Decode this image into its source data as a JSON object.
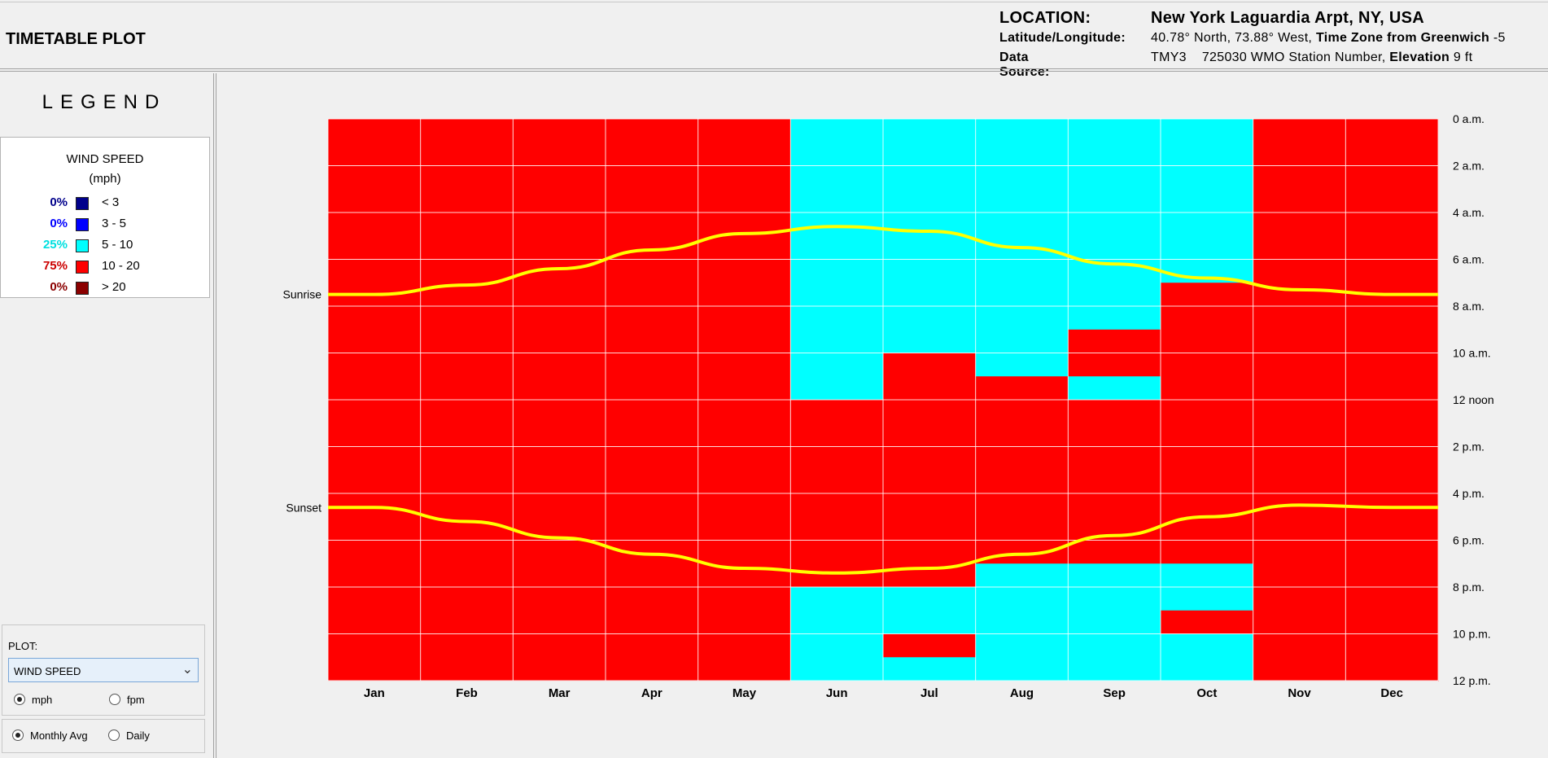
{
  "header": {
    "app_title": "TIMETABLE PLOT",
    "location_label": "LOCATION:",
    "location_value": "New York Laguardia Arpt, NY, USA",
    "latlon_label": "Latitude/Longitude:",
    "latlon_value": "40.78° North, 73.88° West,",
    "timezone_label": "Time Zone from Greenwich",
    "timezone_value": "-5",
    "source_label": "Data Source:",
    "source_value": "TMY3",
    "station_value": "725030 WMO Station Number,",
    "elevation_label": "Elevation",
    "elevation_value": "9 ft"
  },
  "legend": {
    "title": "LEGEND",
    "heading": "WIND SPEED",
    "unit": "(mph)",
    "rows": [
      {
        "pct": "0%",
        "range": "< 3",
        "color": "#00008b",
        "pct_color": "#00008b"
      },
      {
        "pct": "0%",
        "range": "3 - 5",
        "color": "#0000ff",
        "pct_color": "#0000ff"
      },
      {
        "pct": "25%",
        "range": "5 - 10",
        "color": "#00ffff",
        "pct_color": "#00e0e0"
      },
      {
        "pct": "75%",
        "range": "10 - 20",
        "color": "#ff0000",
        "pct_color": "#cc0000"
      },
      {
        "pct": "0%",
        "range": "> 20",
        "color": "#8b0000",
        "pct_color": "#8b0000"
      }
    ]
  },
  "controls": {
    "plot_label": "PLOT:",
    "plot_selected": "WIND SPEED",
    "unit_options": [
      "mph",
      "fpm"
    ],
    "unit_selected": "mph",
    "avg_options": [
      "Monthly Avg",
      "Daily"
    ],
    "avg_selected": "Monthly Avg"
  },
  "chart_data": {
    "type": "heatmap",
    "x": [
      "Jan",
      "Feb",
      "Mar",
      "Apr",
      "May",
      "Jun",
      "Jul",
      "Aug",
      "Sep",
      "Oct",
      "Nov",
      "Dec"
    ],
    "y_ticks": [
      "0 a.m.",
      "2 a.m.",
      "4 a.m.",
      "6 a.m.",
      "8 a.m.",
      "10 a.m.",
      "12 noon",
      "2 p.m.",
      "4 p.m.",
      "6 p.m.",
      "8 p.m.",
      "10 p.m.",
      "12 p.m."
    ],
    "y_range_hours": [
      0,
      24
    ],
    "colors": {
      "5-10": "#00ffff",
      "10-20": "#ff0000"
    },
    "cells": [
      [
        "10-20",
        "10-20",
        "10-20",
        "10-20",
        "10-20",
        "10-20",
        "10-20",
        "10-20",
        "10-20",
        "10-20",
        "10-20",
        "10-20",
        "10-20",
        "10-20",
        "10-20",
        "10-20",
        "10-20",
        "10-20",
        "10-20",
        "10-20",
        "10-20",
        "10-20",
        "10-20",
        "10-20"
      ],
      [
        "10-20",
        "10-20",
        "10-20",
        "10-20",
        "10-20",
        "10-20",
        "10-20",
        "10-20",
        "10-20",
        "10-20",
        "10-20",
        "10-20",
        "10-20",
        "10-20",
        "10-20",
        "10-20",
        "10-20",
        "10-20",
        "10-20",
        "10-20",
        "10-20",
        "10-20",
        "10-20",
        "10-20"
      ],
      [
        "10-20",
        "10-20",
        "10-20",
        "10-20",
        "10-20",
        "10-20",
        "10-20",
        "10-20",
        "10-20",
        "10-20",
        "10-20",
        "10-20",
        "10-20",
        "10-20",
        "10-20",
        "10-20",
        "10-20",
        "10-20",
        "10-20",
        "10-20",
        "10-20",
        "10-20",
        "10-20",
        "10-20"
      ],
      [
        "10-20",
        "10-20",
        "10-20",
        "10-20",
        "10-20",
        "10-20",
        "10-20",
        "10-20",
        "10-20",
        "10-20",
        "10-20",
        "10-20",
        "10-20",
        "10-20",
        "10-20",
        "10-20",
        "10-20",
        "10-20",
        "10-20",
        "10-20",
        "10-20",
        "10-20",
        "10-20",
        "10-20"
      ],
      [
        "10-20",
        "10-20",
        "10-20",
        "10-20",
        "10-20",
        "10-20",
        "10-20",
        "10-20",
        "10-20",
        "10-20",
        "10-20",
        "10-20",
        "10-20",
        "10-20",
        "10-20",
        "10-20",
        "10-20",
        "10-20",
        "10-20",
        "10-20",
        "10-20",
        "10-20",
        "10-20",
        "10-20"
      ],
      [
        "5-10",
        "5-10",
        "5-10",
        "5-10",
        "5-10",
        "5-10",
        "5-10",
        "5-10",
        "5-10",
        "5-10",
        "5-10",
        "5-10",
        "10-20",
        "10-20",
        "10-20",
        "10-20",
        "10-20",
        "10-20",
        "10-20",
        "10-20",
        "5-10",
        "5-10",
        "5-10",
        "5-10"
      ],
      [
        "5-10",
        "5-10",
        "5-10",
        "5-10",
        "5-10",
        "5-10",
        "5-10",
        "5-10",
        "5-10",
        "5-10",
        "10-20",
        "10-20",
        "10-20",
        "10-20",
        "10-20",
        "10-20",
        "10-20",
        "10-20",
        "10-20",
        "10-20",
        "5-10",
        "5-10",
        "10-20",
        "5-10"
      ],
      [
        "5-10",
        "5-10",
        "5-10",
        "5-10",
        "5-10",
        "5-10",
        "5-10",
        "5-10",
        "5-10",
        "5-10",
        "5-10",
        "10-20",
        "10-20",
        "10-20",
        "10-20",
        "10-20",
        "10-20",
        "10-20",
        "10-20",
        "5-10",
        "5-10",
        "5-10",
        "5-10",
        "5-10"
      ],
      [
        "5-10",
        "5-10",
        "5-10",
        "5-10",
        "5-10",
        "5-10",
        "5-10",
        "5-10",
        "5-10",
        "10-20",
        "10-20",
        "5-10",
        "10-20",
        "10-20",
        "10-20",
        "10-20",
        "10-20",
        "10-20",
        "10-20",
        "5-10",
        "5-10",
        "5-10",
        "5-10",
        "5-10"
      ],
      [
        "5-10",
        "5-10",
        "5-10",
        "5-10",
        "5-10",
        "5-10",
        "5-10",
        "10-20",
        "10-20",
        "10-20",
        "10-20",
        "10-20",
        "10-20",
        "10-20",
        "10-20",
        "10-20",
        "10-20",
        "10-20",
        "10-20",
        "5-10",
        "5-10",
        "10-20",
        "5-10",
        "5-10"
      ],
      [
        "10-20",
        "10-20",
        "10-20",
        "10-20",
        "10-20",
        "10-20",
        "10-20",
        "10-20",
        "10-20",
        "10-20",
        "10-20",
        "10-20",
        "10-20",
        "10-20",
        "10-20",
        "10-20",
        "10-20",
        "10-20",
        "10-20",
        "10-20",
        "10-20",
        "10-20",
        "10-20",
        "10-20"
      ],
      [
        "10-20",
        "10-20",
        "10-20",
        "10-20",
        "10-20",
        "10-20",
        "10-20",
        "10-20",
        "10-20",
        "10-20",
        "10-20",
        "10-20",
        "10-20",
        "10-20",
        "10-20",
        "10-20",
        "10-20",
        "10-20",
        "10-20",
        "10-20",
        "10-20",
        "10-20",
        "10-20",
        "10-20"
      ]
    ],
    "sunrise_label": "Sunrise",
    "sunset_label": "Sunset",
    "sunrise_hours": [
      7.5,
      7.1,
      6.4,
      5.6,
      4.9,
      4.6,
      4.8,
      5.5,
      6.2,
      6.8,
      7.3,
      7.5
    ],
    "sunset_hours": [
      16.6,
      17.2,
      17.9,
      18.6,
      19.2,
      19.4,
      19.2,
      18.6,
      17.8,
      17.0,
      16.5,
      16.6
    ],
    "line_color": "#ffff00"
  }
}
